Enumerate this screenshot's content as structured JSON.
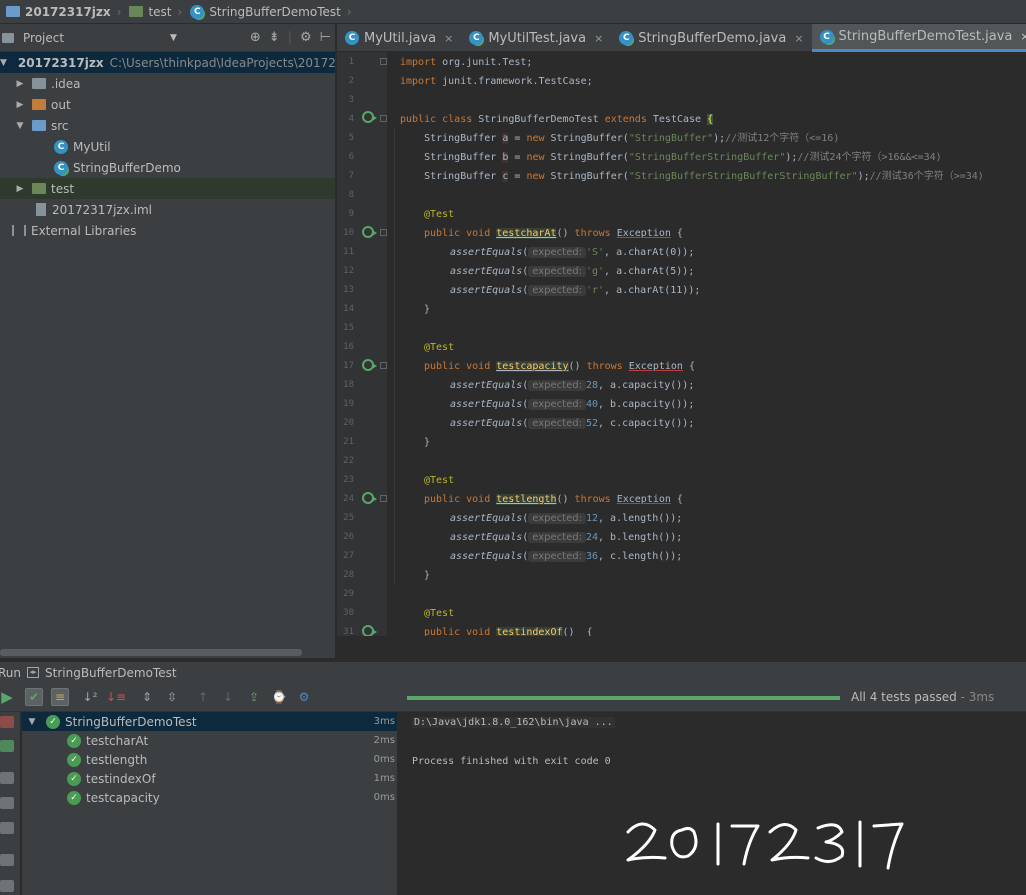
{
  "breadcrumb": [
    {
      "label": "20172317jzx",
      "icon": "project-folder-icon"
    },
    {
      "label": "test",
      "icon": "folder-icon"
    },
    {
      "label": "StringBufferDemoTest",
      "icon": "test-class-icon"
    }
  ],
  "project_panel": {
    "title": "Project",
    "root_label": "20172317jzx",
    "root_path": "C:\\Users\\thinkpad\\IdeaProjects\\20172",
    "items": [
      {
        "label": ".idea"
      },
      {
        "label": "out"
      },
      {
        "label": "src"
      },
      {
        "label": "MyUtil"
      },
      {
        "label": "StringBufferDemo"
      },
      {
        "label": "test"
      },
      {
        "label": "20172317jzx.iml"
      },
      {
        "label": "External Libraries"
      }
    ]
  },
  "editor": {
    "tabs": [
      {
        "label": "MyUtil.java",
        "active": false
      },
      {
        "label": "MyUtilTest.java",
        "active": false
      },
      {
        "label": "StringBufferDemo.java",
        "active": false
      },
      {
        "label": "StringBufferDemoTest.java",
        "active": true
      }
    ],
    "line_numbers": [
      "1",
      "2",
      "3",
      "4",
      "5",
      "6",
      "7",
      "8",
      "9",
      "10",
      "11",
      "12",
      "13",
      "14",
      "15",
      "16",
      "17",
      "18",
      "19",
      "20",
      "21",
      "22",
      "23",
      "24",
      "25",
      "26",
      "27",
      "28",
      "29",
      "30",
      "31"
    ],
    "code": {
      "l1_kw": "import",
      "l1_rest": " org.junit.Test;",
      "l2_kw": "import",
      "l2_rest": " junit.framework.TestCase;",
      "l4_kw1": "public class",
      "l4_name": " StringBufferDemoTest ",
      "l4_kw2": "extends",
      "l4_rest": " TestCase ",
      "l4_brace": "{",
      "l5_a": "    StringBuffer ",
      "l5_var": "a",
      "l5_b": " = ",
      "l5_new": "new",
      "l5_c": " StringBuffer(",
      "l5_str": "\"StringBuffer\"",
      "l5_d": ");",
      "l5_cmt": "//测试12个字符（<=16)",
      "l6_a": "    StringBuffer ",
      "l6_var": "b",
      "l6_b": " = ",
      "l6_new": "new",
      "l6_c": " StringBuffer(",
      "l6_str": "\"StringBufferStringBuffer\"",
      "l6_d": ");",
      "l6_cmt": "//测试24个字符（>16&&<=34)",
      "l7_a": "    StringBuffer ",
      "l7_var": "c",
      "l7_b": " = ",
      "l7_new": "new",
      "l7_c": " StringBuffer(",
      "l7_str": "\"StringBufferStringBufferStringBuffer\"",
      "l7_d": ");",
      "l7_cmt": "//测试36个字符（>=34)",
      "annotation": "@Test",
      "public_void": "public void",
      "throws": "throws",
      "exception": "Exception",
      "assert_fn": "assertEquals",
      "hint": "expected:",
      "m1_name": "testcharAt",
      "m1_l11_val": "'S'",
      "m1_l11_rest": ", a.charAt(0));",
      "m1_l12_val": "'g'",
      "m1_l12_rest": ", a.charAt(5));",
      "m1_l13_val": "'r'",
      "m1_l13_rest": ", a.charAt(11));",
      "m2_name": "testcapacity",
      "m2_l18_val": "28",
      "m2_l18_rest": ", a.capacity());",
      "m2_l19_val": "40",
      "m2_l19_rest": ", b.capacity());",
      "m2_l20_val": "52",
      "m2_l20_rest": ", c.capacity());",
      "m3_name": "testlength",
      "m3_l25_val": "12",
      "m3_l25_rest": ", a.length());",
      "m3_l26_val": "24",
      "m3_l26_rest": ", b.length());",
      "m3_l27_val": "36",
      "m3_l27_rest": ", c.length());",
      "m4_name": "testindexOf",
      "close_brace": "}",
      "paren_open": "() ",
      "brace_open": " {",
      "paren_call": "("
    }
  },
  "run": {
    "label": "Run",
    "config": "StringBufferDemoTest",
    "status_text": "All 4 tests passed",
    "status_time": " - 3ms",
    "progress": 1.0,
    "tree": [
      {
        "label": "StringBufferDemoTest",
        "time": "3ms",
        "root": true
      },
      {
        "label": "testcharAt",
        "time": "2ms"
      },
      {
        "label": "testlength",
        "time": "0ms"
      },
      {
        "label": "testindexOf",
        "time": "1ms"
      },
      {
        "label": "testcapacity",
        "time": "0ms"
      }
    ],
    "console": [
      "D:\\Java\\jdk1.8.0_162\\bin\\java ...",
      "Process finished with exit code 0"
    ],
    "handwritten": "20172317"
  },
  "colors": {
    "accent": "#4a88c7",
    "pass": "#59a869",
    "keyword": "#cc7832",
    "string": "#6a8759",
    "annotation": "#bbb529"
  }
}
